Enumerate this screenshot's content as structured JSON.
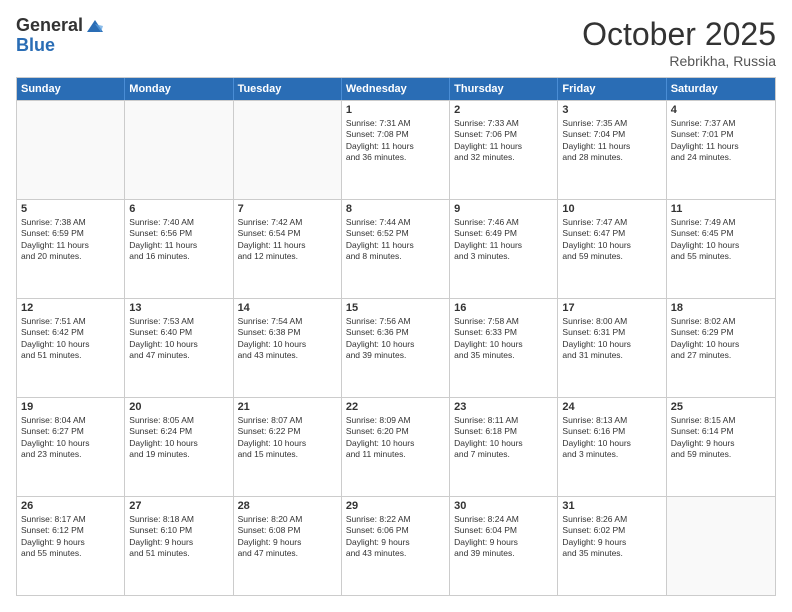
{
  "logo": {
    "general": "General",
    "blue": "Blue"
  },
  "title": "October 2025",
  "subtitle": "Rebrikha, Russia",
  "headers": [
    "Sunday",
    "Monday",
    "Tuesday",
    "Wednesday",
    "Thursday",
    "Friday",
    "Saturday"
  ],
  "weeks": [
    [
      {
        "day": "",
        "info": "",
        "empty": true
      },
      {
        "day": "",
        "info": "",
        "empty": true
      },
      {
        "day": "",
        "info": "",
        "empty": true
      },
      {
        "day": "1",
        "info": "Sunrise: 7:31 AM\nSunset: 7:08 PM\nDaylight: 11 hours\nand 36 minutes."
      },
      {
        "day": "2",
        "info": "Sunrise: 7:33 AM\nSunset: 7:06 PM\nDaylight: 11 hours\nand 32 minutes."
      },
      {
        "day": "3",
        "info": "Sunrise: 7:35 AM\nSunset: 7:04 PM\nDaylight: 11 hours\nand 28 minutes."
      },
      {
        "day": "4",
        "info": "Sunrise: 7:37 AM\nSunset: 7:01 PM\nDaylight: 11 hours\nand 24 minutes."
      }
    ],
    [
      {
        "day": "5",
        "info": "Sunrise: 7:38 AM\nSunset: 6:59 PM\nDaylight: 11 hours\nand 20 minutes."
      },
      {
        "day": "6",
        "info": "Sunrise: 7:40 AM\nSunset: 6:56 PM\nDaylight: 11 hours\nand 16 minutes."
      },
      {
        "day": "7",
        "info": "Sunrise: 7:42 AM\nSunset: 6:54 PM\nDaylight: 11 hours\nand 12 minutes."
      },
      {
        "day": "8",
        "info": "Sunrise: 7:44 AM\nSunset: 6:52 PM\nDaylight: 11 hours\nand 8 minutes."
      },
      {
        "day": "9",
        "info": "Sunrise: 7:46 AM\nSunset: 6:49 PM\nDaylight: 11 hours\nand 3 minutes."
      },
      {
        "day": "10",
        "info": "Sunrise: 7:47 AM\nSunset: 6:47 PM\nDaylight: 10 hours\nand 59 minutes."
      },
      {
        "day": "11",
        "info": "Sunrise: 7:49 AM\nSunset: 6:45 PM\nDaylight: 10 hours\nand 55 minutes."
      }
    ],
    [
      {
        "day": "12",
        "info": "Sunrise: 7:51 AM\nSunset: 6:42 PM\nDaylight: 10 hours\nand 51 minutes."
      },
      {
        "day": "13",
        "info": "Sunrise: 7:53 AM\nSunset: 6:40 PM\nDaylight: 10 hours\nand 47 minutes."
      },
      {
        "day": "14",
        "info": "Sunrise: 7:54 AM\nSunset: 6:38 PM\nDaylight: 10 hours\nand 43 minutes."
      },
      {
        "day": "15",
        "info": "Sunrise: 7:56 AM\nSunset: 6:36 PM\nDaylight: 10 hours\nand 39 minutes."
      },
      {
        "day": "16",
        "info": "Sunrise: 7:58 AM\nSunset: 6:33 PM\nDaylight: 10 hours\nand 35 minutes."
      },
      {
        "day": "17",
        "info": "Sunrise: 8:00 AM\nSunset: 6:31 PM\nDaylight: 10 hours\nand 31 minutes."
      },
      {
        "day": "18",
        "info": "Sunrise: 8:02 AM\nSunset: 6:29 PM\nDaylight: 10 hours\nand 27 minutes."
      }
    ],
    [
      {
        "day": "19",
        "info": "Sunrise: 8:04 AM\nSunset: 6:27 PM\nDaylight: 10 hours\nand 23 minutes."
      },
      {
        "day": "20",
        "info": "Sunrise: 8:05 AM\nSunset: 6:24 PM\nDaylight: 10 hours\nand 19 minutes."
      },
      {
        "day": "21",
        "info": "Sunrise: 8:07 AM\nSunset: 6:22 PM\nDaylight: 10 hours\nand 15 minutes."
      },
      {
        "day": "22",
        "info": "Sunrise: 8:09 AM\nSunset: 6:20 PM\nDaylight: 10 hours\nand 11 minutes."
      },
      {
        "day": "23",
        "info": "Sunrise: 8:11 AM\nSunset: 6:18 PM\nDaylight: 10 hours\nand 7 minutes."
      },
      {
        "day": "24",
        "info": "Sunrise: 8:13 AM\nSunset: 6:16 PM\nDaylight: 10 hours\nand 3 minutes."
      },
      {
        "day": "25",
        "info": "Sunrise: 8:15 AM\nSunset: 6:14 PM\nDaylight: 9 hours\nand 59 minutes."
      }
    ],
    [
      {
        "day": "26",
        "info": "Sunrise: 8:17 AM\nSunset: 6:12 PM\nDaylight: 9 hours\nand 55 minutes."
      },
      {
        "day": "27",
        "info": "Sunrise: 8:18 AM\nSunset: 6:10 PM\nDaylight: 9 hours\nand 51 minutes."
      },
      {
        "day": "28",
        "info": "Sunrise: 8:20 AM\nSunset: 6:08 PM\nDaylight: 9 hours\nand 47 minutes."
      },
      {
        "day": "29",
        "info": "Sunrise: 8:22 AM\nSunset: 6:06 PM\nDaylight: 9 hours\nand 43 minutes."
      },
      {
        "day": "30",
        "info": "Sunrise: 8:24 AM\nSunset: 6:04 PM\nDaylight: 9 hours\nand 39 minutes."
      },
      {
        "day": "31",
        "info": "Sunrise: 8:26 AM\nSunset: 6:02 PM\nDaylight: 9 hours\nand 35 minutes."
      },
      {
        "day": "",
        "info": "",
        "empty": true
      }
    ]
  ]
}
